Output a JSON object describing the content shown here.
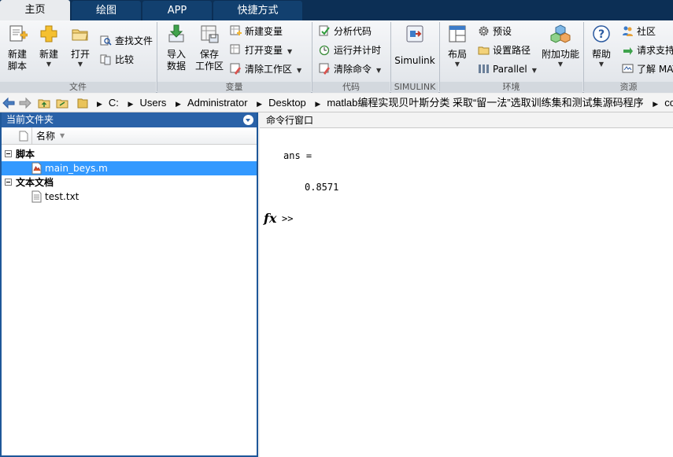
{
  "tabs": [
    {
      "label": "主页"
    },
    {
      "label": "绘图"
    },
    {
      "label": "APP"
    },
    {
      "label": "快捷方式"
    }
  ],
  "ribbon": {
    "file": {
      "section_label": "文件",
      "new_script": "新建\n脚本",
      "new": "新建",
      "open": "打开",
      "find_files": "查找文件",
      "compare": "比较"
    },
    "variable": {
      "section_label": "变量",
      "import_data": "导入\n数据",
      "save_workspace": "保存\n工作区",
      "new_variable": "新建变量",
      "open_variable": "打开变量",
      "clear_workspace": "清除工作区"
    },
    "code": {
      "section_label": "代码",
      "analyze_code": "分析代码",
      "run_and_time": "运行并计时",
      "clear_commands": "清除命令"
    },
    "simulink": {
      "section_label": "SIMULINK",
      "simulink": "Simulink"
    },
    "environment": {
      "section_label": "环境",
      "layout": "布局",
      "preferences": "预设",
      "set_path": "设置路径",
      "parallel": "Parallel",
      "add_ons": "附加功能"
    },
    "resources": {
      "section_label": "资源",
      "help": "帮助",
      "community": "社区",
      "request_support": "请求支持",
      "learn_matlab": "了解 MAT"
    }
  },
  "address": {
    "crumbs": [
      "C:",
      "Users",
      "Administrator",
      "Desktop",
      "matlab编程实现贝叶斯分类 采取“留一法”选取训练集和测试集源码程序",
      "code"
    ]
  },
  "current_folder": {
    "title": "当前文件夹",
    "column_name": "名称",
    "groups": [
      {
        "label": "脚本",
        "files": [
          {
            "name": "main_beys.m"
          }
        ]
      },
      {
        "label": "文本文档",
        "files": [
          {
            "name": "test.txt"
          }
        ]
      }
    ]
  },
  "command_window": {
    "title": "命令行窗口",
    "output_var": "ans =",
    "output_value": "0.8571",
    "prompt": ">>",
    "fx": "fx"
  }
}
